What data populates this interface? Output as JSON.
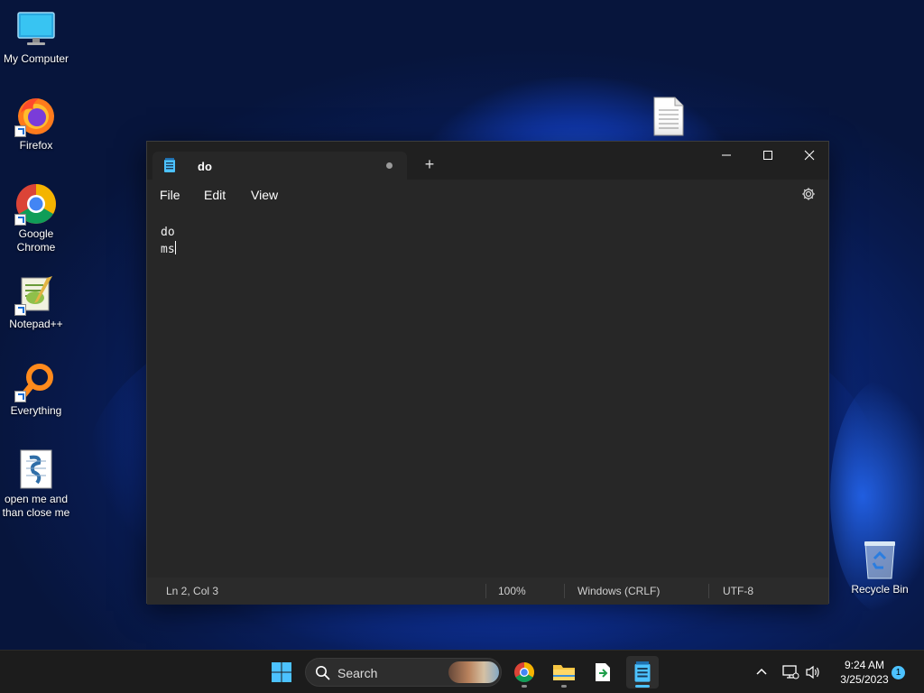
{
  "desktop": {
    "icons": [
      {
        "label": "My Computer",
        "icon": "monitor-icon"
      },
      {
        "label": "Firefox",
        "icon": "firefox-icon"
      },
      {
        "label": "Google Chrome",
        "icon": "chrome-icon"
      },
      {
        "label": "Notepad++",
        "icon": "notepadpp-icon"
      },
      {
        "label": "Everything",
        "icon": "everything-icon"
      },
      {
        "label": "open me and than close me",
        "icon": "script-file-icon"
      },
      {
        "label": "Recycle Bin",
        "icon": "recycle-bin-icon"
      }
    ],
    "blank_file_icon": "text-file-icon"
  },
  "notepad": {
    "tab_title": "do",
    "new_tab_symbol": "+",
    "menu": {
      "file": "File",
      "edit": "Edit",
      "view": "View"
    },
    "content": {
      "line1": "do",
      "line2": "ms"
    },
    "status": {
      "position": "Ln 2, Col 3",
      "zoom": "100%",
      "line_ending": "Windows (CRLF)",
      "encoding": "UTF-8"
    }
  },
  "taskbar": {
    "search_label": "Search",
    "time": "9:24 AM",
    "date": "3/25/2023",
    "notification_count": "1"
  },
  "colors": {
    "accent": "#4cc2ff",
    "window_bg": "#272727",
    "titlebar_bg": "#202020",
    "taskbar_bg": "#1c1c1c"
  }
}
